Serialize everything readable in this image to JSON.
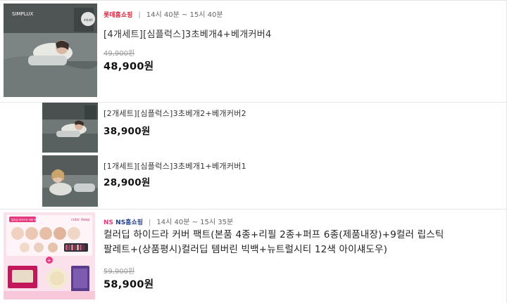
{
  "products": [
    {
      "channel": "롯데홈쇼핑",
      "time": "14시 40분 ~ 15시 40분",
      "title": "[4개세트][심플럭스]3초베개4+베개커버4",
      "original_price": "49,900원",
      "price": "48,900원",
      "thumb_brand": "SIMPLUX",
      "thumb_badge": "4개세트"
    },
    {
      "title": "[2개세트][심플럭스]3초베개2+베개커버2",
      "price": "38,900원"
    },
    {
      "title": "[1개세트][심플럭스]3초베개1+베개커버1",
      "price": "28,900원"
    },
    {
      "channel": "NS홈쇼핑",
      "channel_badge": "NS",
      "time": "14시 40분 ~ 15시 35분",
      "title_line1": "컬러딥 하이드라 커버 팩트(본품 4종+리필 2종+퍼프 6종(제품내장)+9컬러 립스틱",
      "title_line2": "팔레트+(상품평시)컬러딥 템버린 빅백+뉴트럴시티 12색 아이섀도우)",
      "original_price": "59,900원",
      "price": "58,900원",
      "thumb_brand": "color deep",
      "thumb_tag": "컬러딥 하이드라 커버 팩트"
    }
  ]
}
